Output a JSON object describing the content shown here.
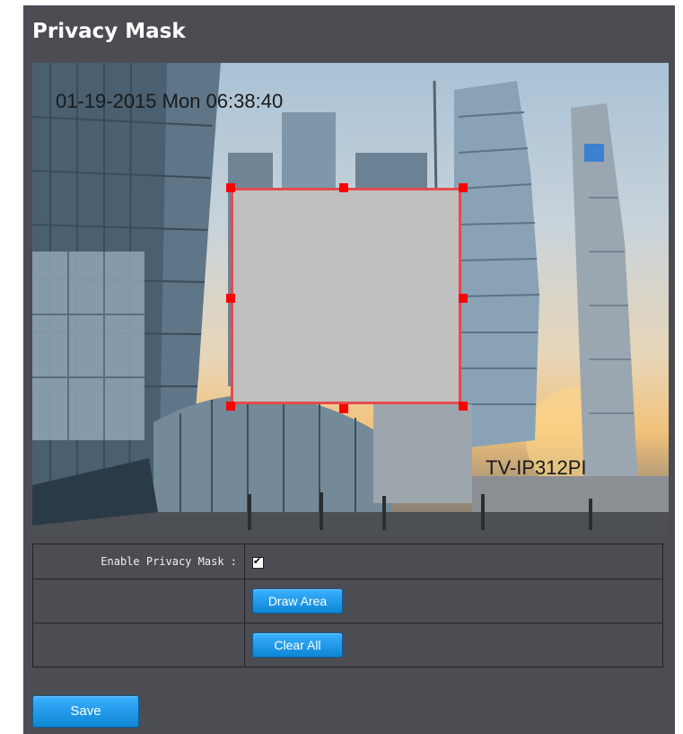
{
  "page": {
    "title": "Privacy Mask"
  },
  "camera": {
    "osd_time": "01-19-2015 Mon  06:38:40",
    "osd_name": "TV-IP312PI"
  },
  "settings": {
    "enable_label": "Enable Privacy Mask :",
    "enable_checked": true,
    "checkmark": "✔",
    "draw_area_label": "Draw Area",
    "clear_all_label": "Clear All"
  },
  "actions": {
    "save_label": "Save"
  },
  "colors": {
    "panel_bg": "#4b4d53",
    "mask_fill": "#c0c0c0",
    "mask_border": "#e54b4b",
    "handle": "#ff0000",
    "button": "#1497e6"
  }
}
